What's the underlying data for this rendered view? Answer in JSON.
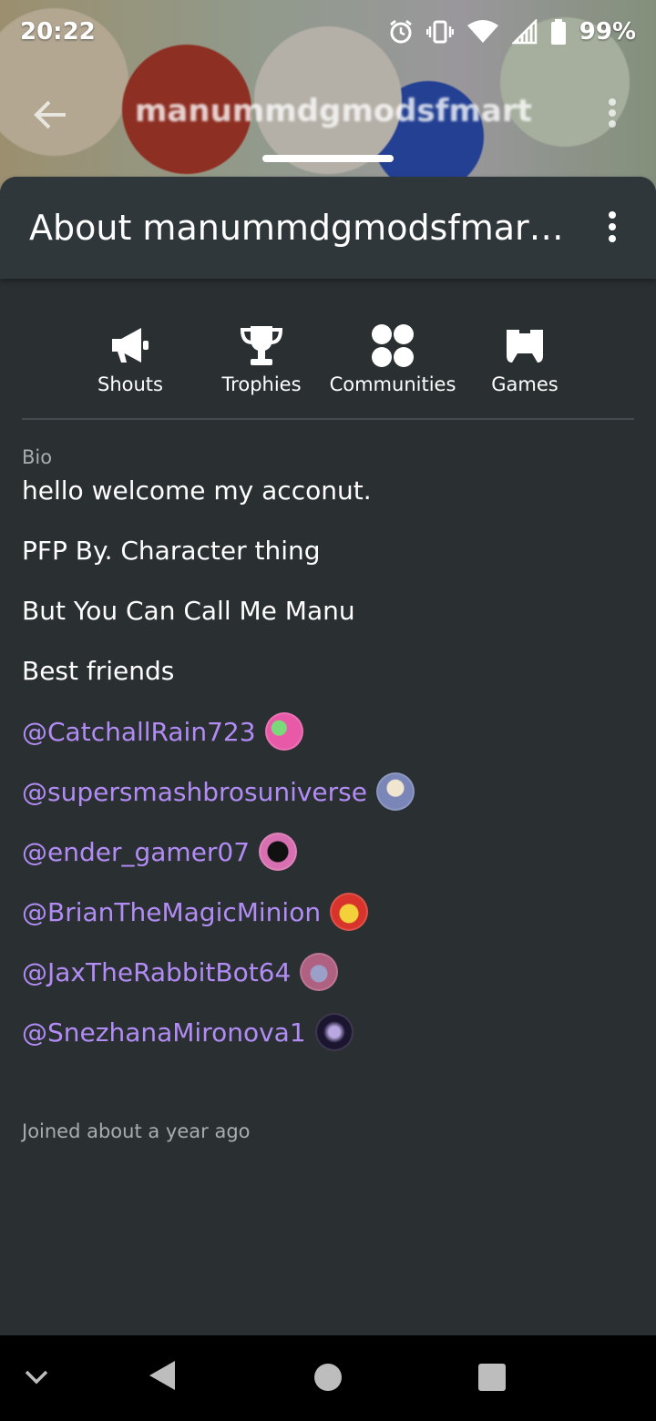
{
  "status_bar": {
    "time": "20:22",
    "battery": "99%",
    "icons": [
      "alarm-icon",
      "vibrate-icon",
      "wifi-icon",
      "signal-icon",
      "battery-icon"
    ]
  },
  "top_bar": {
    "title": "manummdgmodsfmart"
  },
  "sheet": {
    "title": "About manummdgmodsfmar…"
  },
  "tabs": [
    {
      "label": "Shouts",
      "icon": "megaphone-icon"
    },
    {
      "label": "Trophies",
      "icon": "trophy-icon"
    },
    {
      "label": "Communities",
      "icon": "communities-icon"
    },
    {
      "label": "Games",
      "icon": "gamepad-icon"
    }
  ],
  "bio": {
    "label": "Bio",
    "lines": [
      "hello  welcome my acconut.",
      "PFP By. Character thing",
      "But You Can Call Me Manu",
      "Best friends"
    ],
    "mentions": [
      {
        "handle": "@CatchallRain723",
        "avatar_color": "#e85aa8"
      },
      {
        "handle": "@supersmashbrosuniverse",
        "avatar_color": "#7a86b8"
      },
      {
        "handle": "@ender_gamer07",
        "avatar_color": "#d86fb0"
      },
      {
        "handle": "@BrianTheMagicMinion",
        "avatar_color": "#e0b420"
      },
      {
        "handle": "@JaxTheRabbitBot64",
        "avatar_color": "#b06080"
      },
      {
        "handle": "@SnezhanaMironova1",
        "avatar_color": "#3a2a5a"
      }
    ]
  },
  "joined": "Joined about a year ago",
  "colors": {
    "background": "#2a2f31",
    "header": "#30373a",
    "mention": "#b28cf5",
    "muted": "#a8adb0"
  },
  "nav": {
    "icons": [
      "chevron-down-icon",
      "back-triangle-icon",
      "home-circle-icon",
      "recents-square-icon"
    ]
  }
}
